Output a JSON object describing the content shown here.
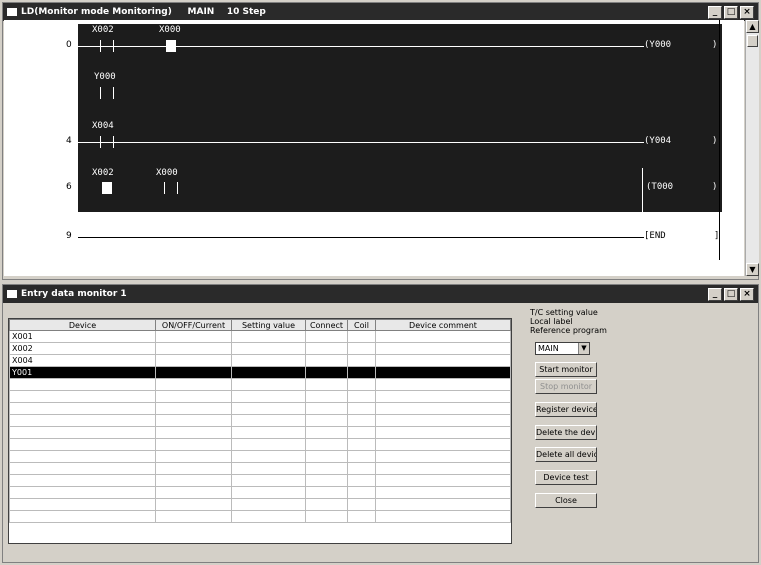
{
  "ladder_window": {
    "title": "LD(Monitor mode Monitoring)     MAIN    10 Step",
    "buttons": {
      "minimize": "_",
      "maximize": "□",
      "close": "×"
    }
  },
  "ladder": {
    "steps": [
      "0",
      "4",
      "6",
      "9"
    ],
    "rungs": [
      {
        "contacts": [
          "X002",
          "X000"
        ],
        "coil": "(Y000",
        "coil_end": ")"
      },
      {
        "contacts": [
          "Y000"
        ]
      },
      {
        "contacts": [
          "X004"
        ],
        "coil": "(Y004",
        "coil_end": ")"
      },
      {
        "contacts": [
          "X002",
          "X000"
        ],
        "coil": "(T000",
        "coil_end": ")"
      },
      {
        "coil": "[END",
        "coil_end": "]"
      }
    ]
  },
  "monitor_window": {
    "title": "Entry data monitor 1",
    "buttons": {
      "minimize": "_",
      "maximize": "□",
      "close": "×"
    }
  },
  "table": {
    "columns": [
      "Device",
      "ON/OFF/Current",
      "Setting value",
      "Connect",
      "Coil",
      "Device comment"
    ],
    "rows": [
      [
        "X001",
        "",
        "",
        "",
        "",
        ""
      ],
      [
        "X002",
        "",
        "",
        "",
        "",
        ""
      ],
      [
        "X004",
        "",
        "",
        "",
        "",
        ""
      ],
      [
        "Y001",
        "",
        "",
        "",
        "",
        ""
      ]
    ]
  },
  "right_panel": {
    "line1": "T/C setting value",
    "line2": "Local label",
    "line3": "Reference program",
    "program_select": "MAIN",
    "start_monitor": "Start monitor",
    "stop_monitor": "Stop monitor",
    "register_devices": "Register devices",
    "delete_device": "Delete the device",
    "delete_all": "Delete all devices",
    "device_test": "Device test",
    "close": "Close"
  }
}
